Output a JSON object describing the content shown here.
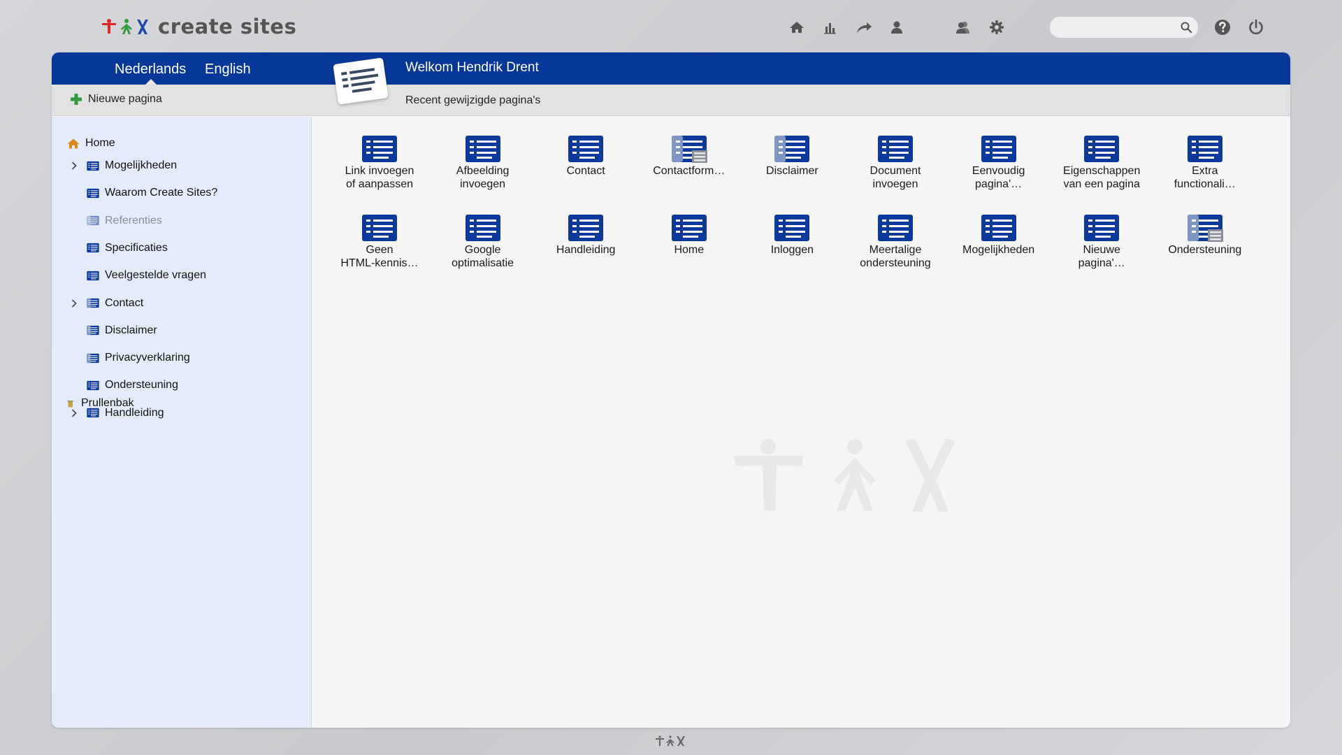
{
  "brand": {
    "name": "create sites"
  },
  "toolbar": {
    "icons": [
      "home-icon",
      "stats-icon",
      "share-icon",
      "user-icon",
      "users-icon",
      "gear-icon"
    ],
    "search": {
      "placeholder": "",
      "value": ""
    },
    "help_icon": "help-icon",
    "power_icon": "power-icon"
  },
  "header": {
    "languages": [
      "Nederlands",
      "English"
    ],
    "active_language": "Nederlands",
    "welcome": "Welkom Hendrik Drent",
    "new_page_label": "Nieuwe pagina",
    "recent_label": "Recent gewijzigde pagina's"
  },
  "sidebar": {
    "home": "Home",
    "items": [
      {
        "label": "Mogelijkheden",
        "expandable": true,
        "muted": false,
        "icon": "page-icon"
      },
      {
        "label": "Waarom Create Sites?",
        "expandable": false,
        "muted": false,
        "icon": "page-icon"
      },
      {
        "label": "Referenties",
        "expandable": false,
        "muted": true,
        "icon": "page-half-icon"
      },
      {
        "label": "Specificaties",
        "expandable": false,
        "muted": false,
        "icon": "page-icon"
      },
      {
        "label": "Veelgestelde vragen",
        "expandable": false,
        "muted": false,
        "icon": "page-icon"
      },
      {
        "label": "Contact",
        "expandable": true,
        "muted": false,
        "icon": "page-half-icon"
      },
      {
        "label": "Disclaimer",
        "expandable": false,
        "muted": false,
        "icon": "page-half-icon"
      },
      {
        "label": "Privacyverklaring",
        "expandable": false,
        "muted": false,
        "icon": "page-half-icon"
      },
      {
        "label": "Ondersteuning",
        "expandable": false,
        "muted": false,
        "icon": "page-icon"
      },
      {
        "label": "Handleiding",
        "expandable": true,
        "muted": false,
        "icon": "page-icon"
      }
    ],
    "trash": "Prullenbak"
  },
  "recent_pages": [
    {
      "line1": "Link invoegen",
      "line2": "of aanpassen",
      "icon": "page-icon"
    },
    {
      "line1": "Afbeelding",
      "line2": "invoegen",
      "icon": "page-icon"
    },
    {
      "line1": "Contact",
      "line2": "",
      "icon": "page-icon"
    },
    {
      "line1": "Contactform…",
      "line2": "",
      "icon": "page-form-icon"
    },
    {
      "line1": "Disclaimer",
      "line2": "",
      "icon": "page-half-icon"
    },
    {
      "line1": "Document",
      "line2": "invoegen",
      "icon": "page-icon"
    },
    {
      "line1": "Eenvoudig",
      "line2": "pagina'…",
      "icon": "page-icon"
    },
    {
      "line1": "Eigenschappen",
      "line2": "van een pagina",
      "icon": "page-icon"
    },
    {
      "line1": "Extra",
      "line2": "functionali…",
      "icon": "page-icon"
    },
    {
      "line1": "Geen",
      "line2": "HTML-kennis…",
      "icon": "page-icon"
    },
    {
      "line1": "Google",
      "line2": "optimalisatie",
      "icon": "page-icon"
    },
    {
      "line1": "Handleiding",
      "line2": "",
      "icon": "page-icon"
    },
    {
      "line1": "Home",
      "line2": "",
      "icon": "page-icon"
    },
    {
      "line1": "Inloggen",
      "line2": "",
      "icon": "page-icon"
    },
    {
      "line1": "Meertalige",
      "line2": "ondersteuning",
      "icon": "page-icon"
    },
    {
      "line1": "Mogelijkheden",
      "line2": "",
      "icon": "page-icon"
    },
    {
      "line1": "Nieuwe",
      "line2": "pagina'…",
      "icon": "page-icon"
    },
    {
      "line1": "Ondersteuning",
      "line2": "",
      "icon": "page-form-icon"
    }
  ],
  "colors": {
    "header_blue": "#073899",
    "icon_blue": "#0b3a9c",
    "sidebar_bg": "#e4ecfc",
    "logo_red": "#e0262a",
    "logo_green": "#2e9b3c",
    "logo_blue": "#1d47a8"
  }
}
